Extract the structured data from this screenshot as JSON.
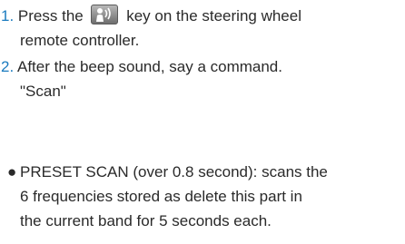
{
  "steps": [
    {
      "number": "1.",
      "before_key": "Press the",
      "after_key": "key on the steering wheel",
      "line2": "remote controller."
    },
    {
      "number": "2.",
      "line1": "After the beep sound, say a command.",
      "line2": "\"Scan\""
    }
  ],
  "key_icon": "voice-talk-icon",
  "accent_color": "#1a7bbf",
  "bullet": {
    "symbol": "●",
    "line1": "PRESET SCAN (over 0.8 second):  scans the",
    "line2": "6 frequencies stored as delete this part in",
    "line3": "the current band for 5 seconds each."
  }
}
